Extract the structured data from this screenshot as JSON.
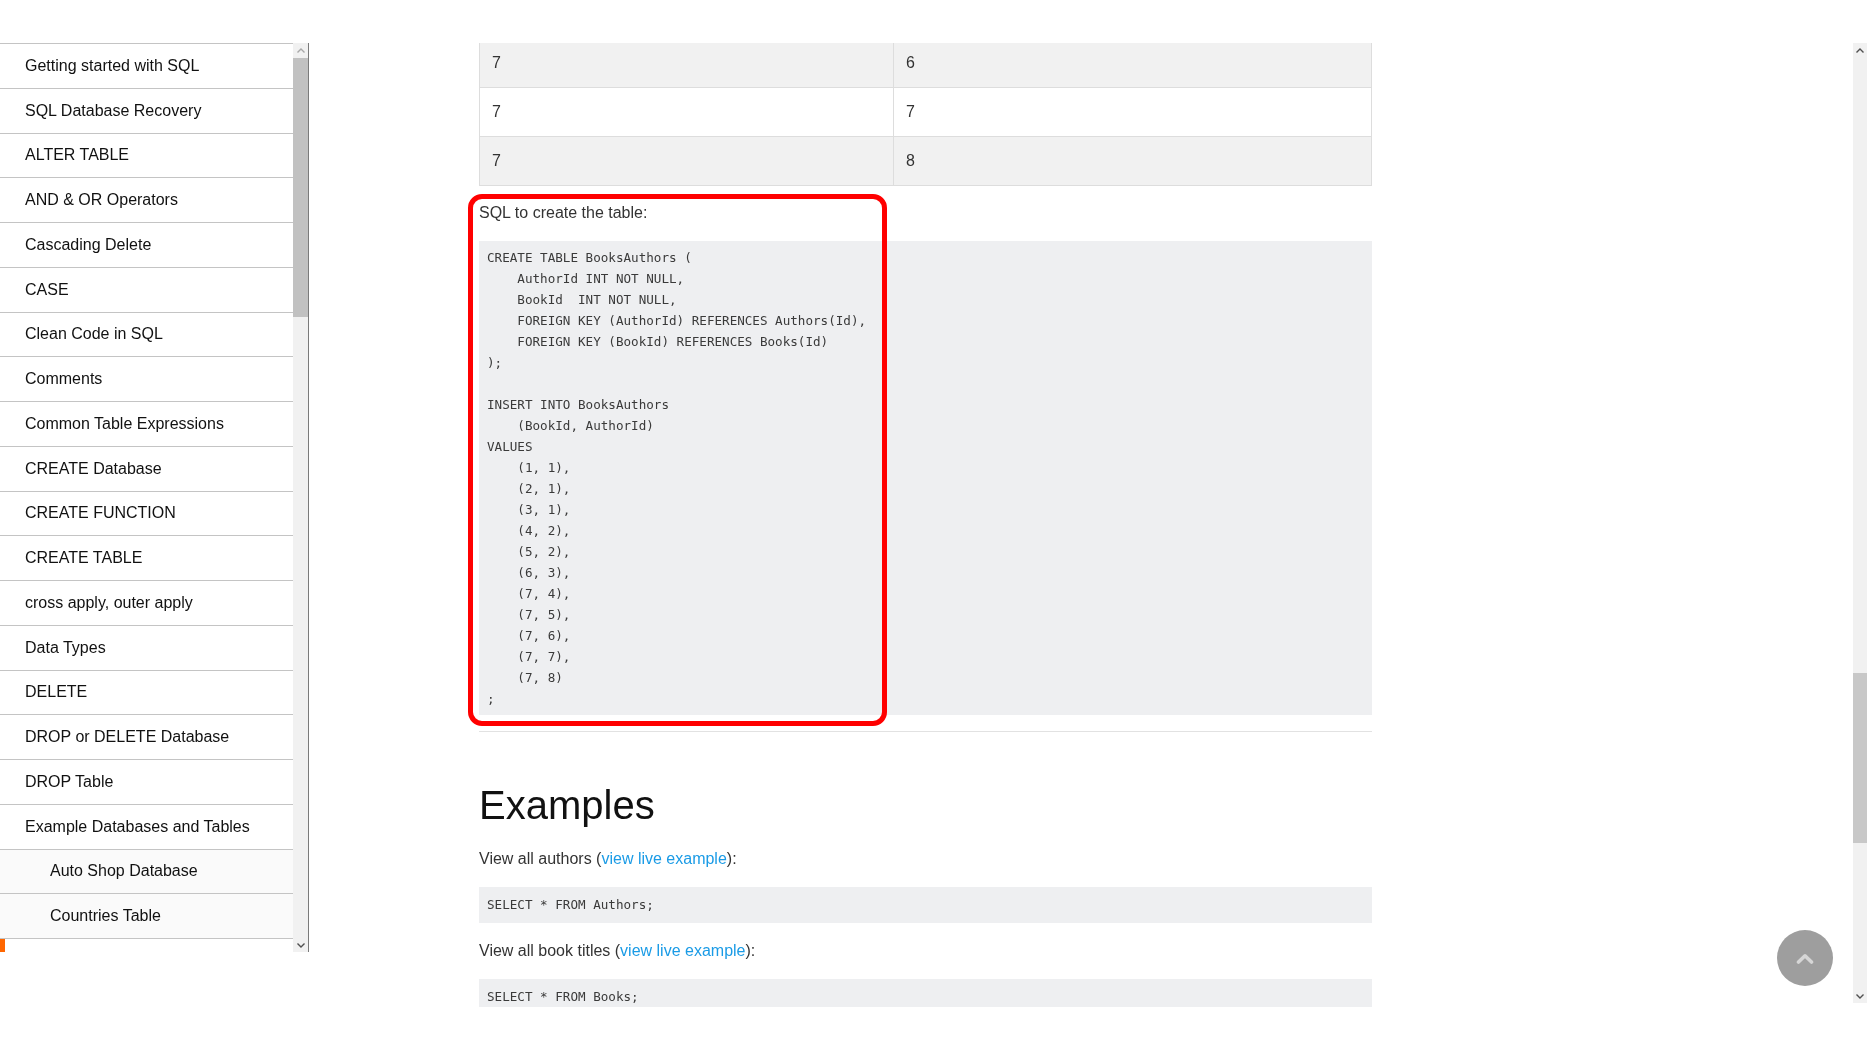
{
  "sidebar": {
    "items": [
      {
        "label": "Getting started with SQL"
      },
      {
        "label": "SQL Database Recovery"
      },
      {
        "label": "ALTER TABLE"
      },
      {
        "label": "AND & OR Operators"
      },
      {
        "label": "Cascading Delete"
      },
      {
        "label": "CASE"
      },
      {
        "label": "Clean Code in SQL"
      },
      {
        "label": "Comments"
      },
      {
        "label": "Common Table Expressions"
      },
      {
        "label": "CREATE Database"
      },
      {
        "label": "CREATE FUNCTION"
      },
      {
        "label": "CREATE TABLE"
      },
      {
        "label": "cross apply, outer apply"
      },
      {
        "label": "Data Types"
      },
      {
        "label": "DELETE"
      },
      {
        "label": "DROP or DELETE Database"
      },
      {
        "label": "DROP Table"
      },
      {
        "label": "Example Databases and Tables",
        "children": [
          {
            "label": "Auto Shop Database"
          },
          {
            "label": "Countries Table"
          }
        ]
      }
    ]
  },
  "table": {
    "rows": [
      [
        "7",
        "6"
      ],
      [
        "7",
        "7"
      ],
      [
        "7",
        "8"
      ]
    ]
  },
  "content": [
    {
      "kind": "paragraph",
      "parts": [
        {
          "kind": "text",
          "text": "SQL to create the table:"
        }
      ]
    },
    {
      "kind": "code",
      "code": "CREATE TABLE BooksAuthors (\n    AuthorId INT NOT NULL,\n    BookId  INT NOT NULL,\n    FOREIGN KEY (AuthorId) REFERENCES Authors(Id),\n    FOREIGN KEY (BookId) REFERENCES Books(Id)\n);\n\nINSERT INTO BooksAuthors\n    (BookId, AuthorId)\nVALUES\n    (1, 1),\n    (2, 1),\n    (3, 1),\n    (4, 2),\n    (5, 2),\n    (6, 3),\n    (7, 4),\n    (7, 5),\n    (7, 6),\n    (7, 7),\n    (7, 8)\n;"
    },
    {
      "kind": "rule"
    },
    {
      "kind": "heading",
      "text": "Examples"
    },
    {
      "kind": "paragraph",
      "parts": [
        {
          "kind": "text",
          "text": "View all authors ("
        },
        {
          "kind": "link",
          "text": "view live example"
        },
        {
          "kind": "text",
          "text": "):"
        }
      ]
    },
    {
      "kind": "code",
      "code": "SELECT * FROM Authors;"
    },
    {
      "kind": "paragraph",
      "parts": [
        {
          "kind": "text",
          "text": "View all book titles ("
        },
        {
          "kind": "link",
          "text": "view live example"
        },
        {
          "kind": "text",
          "text": "):"
        }
      ]
    },
    {
      "kind": "code",
      "code": "SELECT * FROM Books;"
    }
  ]
}
